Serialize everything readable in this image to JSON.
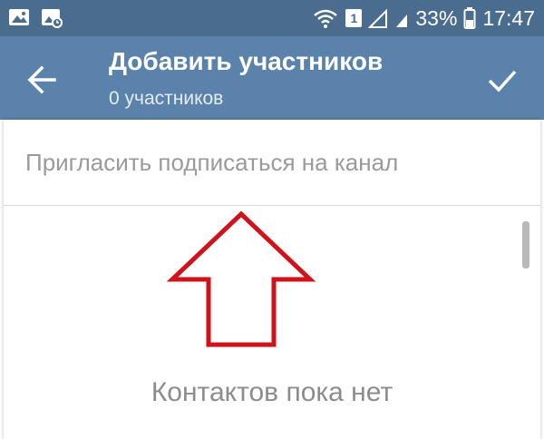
{
  "status_bar": {
    "sim_number": "1",
    "battery": "33%",
    "time": "17:47",
    "icons": [
      "gallery-icon",
      "screenshot-icon",
      "wifi-icon",
      "sim-icon",
      "signal-icon",
      "battery-icon"
    ]
  },
  "app_bar": {
    "title": "Добавить участников",
    "subtitle": "0 участников",
    "back_icon": "arrow-left-icon",
    "confirm_icon": "checkmark-icon"
  },
  "search": {
    "placeholder": "Пригласить подписаться на канал",
    "value": ""
  },
  "annotation": {
    "icon": "arrow-up-icon",
    "color": "#d0121b"
  },
  "empty_state": {
    "text": "Контактов пока нет"
  },
  "colors": {
    "status_bar": "#4a6c8f",
    "app_bar": "#5b82ab",
    "placeholder": "#9a9a9a",
    "empty_text": "#8c8c8c"
  }
}
